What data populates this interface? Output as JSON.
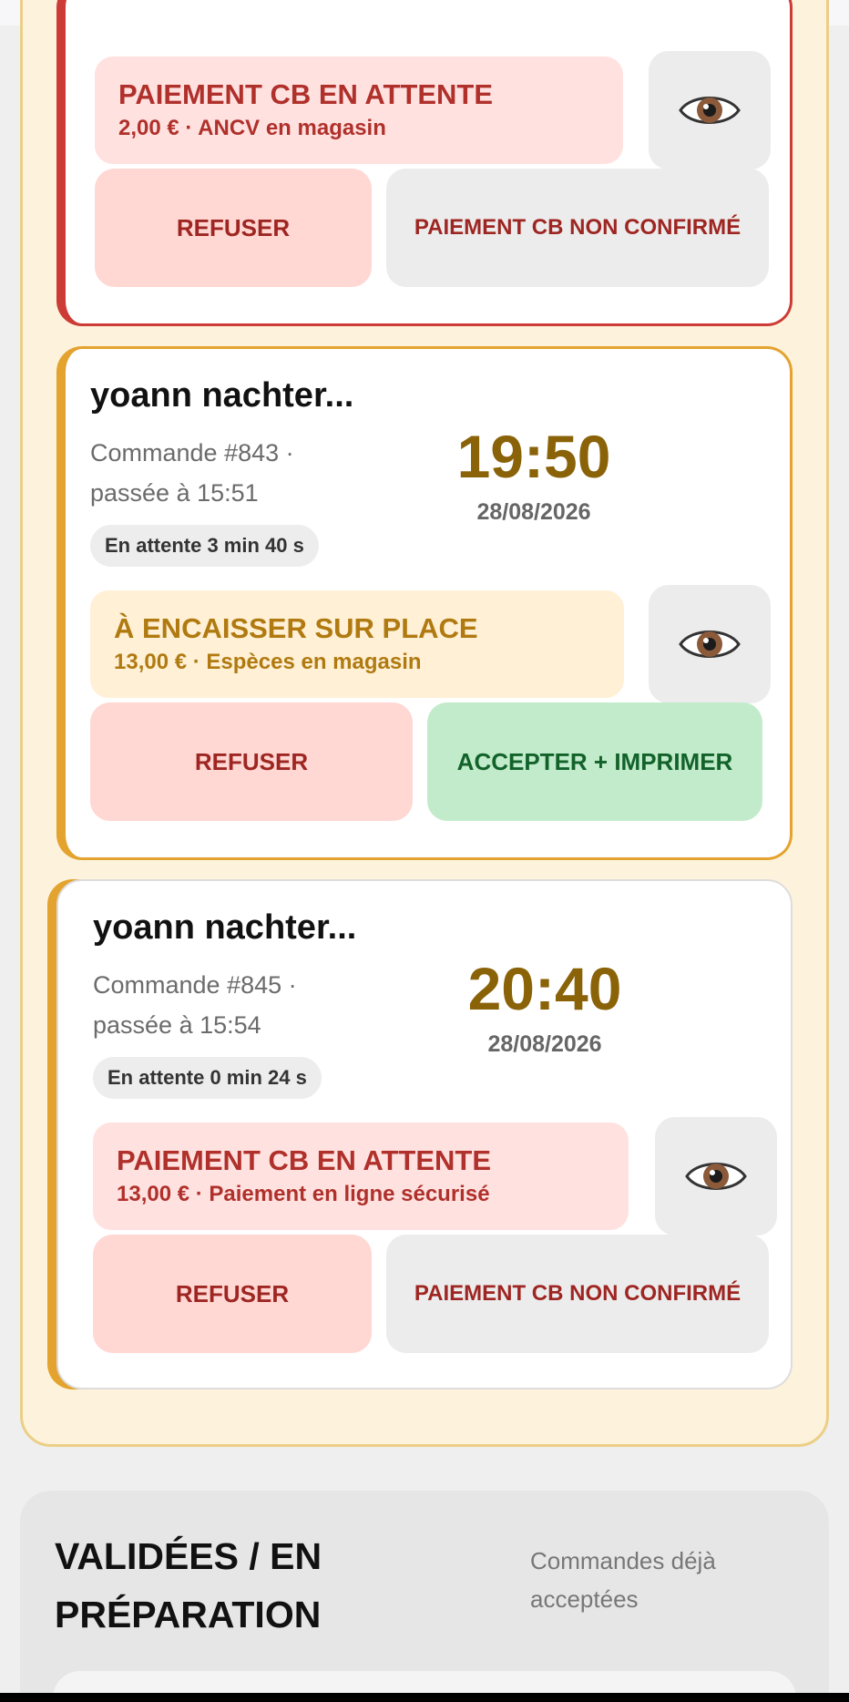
{
  "cards": [
    {
      "payment": {
        "title": "PAIEMENT CB EN ATTENTE",
        "subtitle": "2,00 € · ANCV en magasin"
      },
      "buttons": {
        "refuse": "REFUSER",
        "secondary": "PAIEMENT CB NON CONFIRMÉ"
      }
    },
    {
      "customer": "yoann nachter...",
      "order_line1": "Commande #843 ·",
      "order_line2": "passée à 15:51",
      "wait": "En attente 3 min 40 s",
      "time": "19:50",
      "date": "28/08/2026",
      "payment": {
        "title": "À ENCAISSER SUR PLACE",
        "subtitle": "13,00 € · Espèces en magasin"
      },
      "buttons": {
        "refuse": "REFUSER",
        "secondary": "ACCEPTER + IMPRIMER"
      }
    },
    {
      "customer": "yoann nachter...",
      "order_line1": "Commande #845 ·",
      "order_line2": "passée à 15:54",
      "wait": "En attente 0 min 24 s",
      "time": "20:40",
      "date": "28/08/2026",
      "payment": {
        "title": "PAIEMENT CB EN ATTENTE",
        "subtitle": "13,00 € · Paiement en ligne sécurisé"
      },
      "buttons": {
        "refuse": "REFUSER",
        "secondary": "PAIEMENT CB NON CONFIRMÉ"
      }
    }
  ],
  "validated": {
    "title_line1": "VALIDÉES / EN",
    "title_line2": "PRÉPARATION",
    "subtitle_line1": "Commandes déjà",
    "subtitle_line2": "acceptées"
  },
  "colors": {
    "pending_panel_bg": "#fdf3dc",
    "urgent_border": "#cd3b36",
    "warning_border": "#e3a32e",
    "time_color": "#8a6208",
    "accept_green": "#c2ebcb",
    "refuse_pink": "#ffd7d3"
  }
}
